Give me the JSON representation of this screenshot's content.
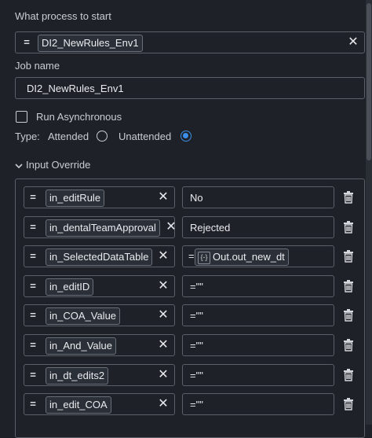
{
  "process": {
    "label": "What process to start",
    "value": "DI2_NewRules_Env1"
  },
  "job": {
    "label": "Job name",
    "value": "DI2_NewRules_Env1"
  },
  "async": {
    "label": "Run Asynchronous"
  },
  "type": {
    "label": "Type:",
    "attended": "Attended",
    "unattended": "Unattended"
  },
  "override": {
    "label": "Input Override",
    "eq": "=",
    "rows": [
      {
        "key": "in_editRule",
        "value": "No",
        "expr": false
      },
      {
        "key": "in_dentalTeamApproval",
        "value": "Rejected",
        "expr": false
      },
      {
        "key": "in_SelectedDataTable",
        "value": "Out.out_new_dt",
        "prefix": "=",
        "expr": true,
        "icon": "{-}"
      },
      {
        "key": "in_editID",
        "value": "=\"\"",
        "expr": false
      },
      {
        "key": "in_COA_Value",
        "value": "=\"\"",
        "expr": false
      },
      {
        "key": "in_And_Value",
        "value": "=\"\"",
        "expr": false
      },
      {
        "key": "in_dt_edits2",
        "value": "=\"\"",
        "expr": false
      },
      {
        "key": "in_edit_COA",
        "value": "=\"\"",
        "expr": false
      }
    ]
  },
  "colors": {
    "background": "#1e2228",
    "accent": "#3b8fe8",
    "border": "#5a5f68"
  }
}
